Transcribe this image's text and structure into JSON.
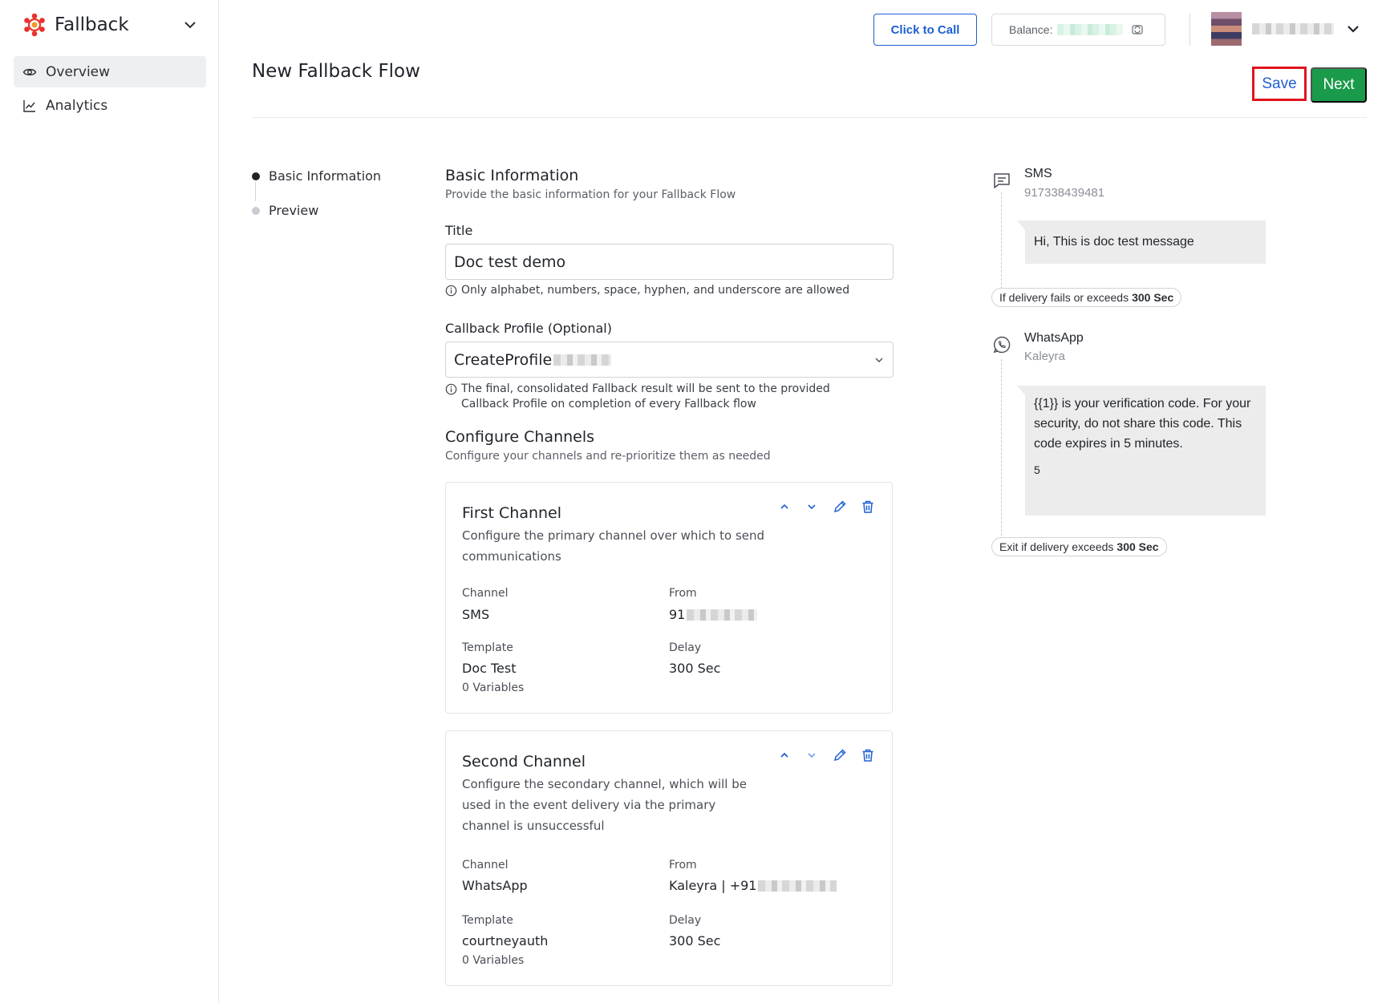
{
  "app": {
    "name": "Fallback"
  },
  "sidebar": {
    "items": [
      {
        "label": "Overview",
        "icon": "eye-icon",
        "active": true
      },
      {
        "label": "Analytics",
        "icon": "line-chart-icon",
        "active": false
      }
    ]
  },
  "header": {
    "click_to_call": "Click to Call",
    "balance_label": "Balance:"
  },
  "page": {
    "title": "New Fallback Flow",
    "save_label": "Save",
    "next_label": "Next"
  },
  "steps": [
    {
      "label": "Basic Information",
      "active": true
    },
    {
      "label": "Preview",
      "active": false
    }
  ],
  "basic_info": {
    "title": "Basic Information",
    "subtitle": "Provide the basic information for your Fallback Flow",
    "title_field_label": "Title",
    "title_field_value": "Doc test demo",
    "title_hint": "Only alphabet, numbers, space, hyphen, and underscore are allowed",
    "callback_label": "Callback Profile (Optional)",
    "callback_value": "CreateProfile",
    "callback_hint": "The final, consolidated Fallback result will be sent to the provided Callback Profile on completion of every Fallback flow"
  },
  "configure": {
    "title": "Configure Channels",
    "subtitle": "Configure your channels and re-prioritize them as needed"
  },
  "channels": [
    {
      "title": "First Channel",
      "desc": "Configure the primary channel over which to send communications",
      "channel_key": "Channel",
      "channel_val": "SMS",
      "from_key": "From",
      "from_val": "91",
      "template_key": "Template",
      "template_val": "Doc Test",
      "variables": "0 Variables",
      "delay_key": "Delay",
      "delay_val": "300 Sec"
    },
    {
      "title": "Second Channel",
      "desc": "Configure the secondary channel, which will be used in the event delivery via the primary channel is unsuccessful",
      "channel_key": "Channel",
      "channel_val": "WhatsApp",
      "from_key": "From",
      "from_val": "Kaleyra | +91",
      "template_key": "Template",
      "template_val": "courtneyauth",
      "variables": "0 Variables",
      "delay_key": "Delay",
      "delay_val": "300 Sec"
    }
  ],
  "preview": {
    "sms_name": "SMS",
    "sms_sender": "917338439481",
    "sms_message": "Hi, This is doc test message",
    "fallback_pill_text": "If delivery fails or exceeds",
    "fallback_pill_value": "300 Sec",
    "wa_name": "WhatsApp",
    "wa_sender": "Kaleyra",
    "wa_message": "{{1}} is your verification code. For your security, do not share this code. This code expires in 5 minutes.",
    "wa_footer": "5",
    "exit_pill_text": "Exit if delivery exceeds",
    "exit_pill_value": "300 Sec"
  },
  "colors": {
    "primary": "#1f5fd1",
    "success": "#1a9b4b",
    "highlight": "#e0141e"
  }
}
